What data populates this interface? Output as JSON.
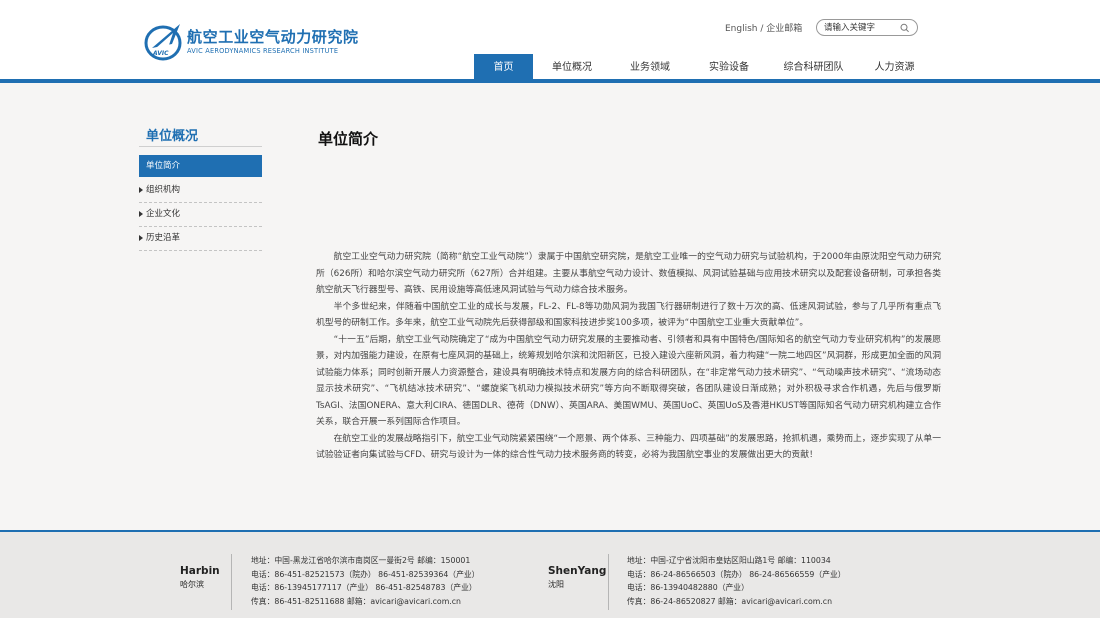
{
  "colors": {
    "brand": "#1f6fb2",
    "background": "#f6f5f4",
    "footer_bg": "#e9e8e7"
  },
  "logo": {
    "icon": "avic-swept-wing-logo-icon",
    "mark_text": "AVIC",
    "title": "航空工业空气动力研究院",
    "subtitle": "AVIC AERODYNAMICS RESEARCH INSTITUTE"
  },
  "header": {
    "english_link": "English",
    "separator": " / ",
    "email_link": "企业邮箱",
    "search": {
      "placeholder": "请输入关键字",
      "icon": "search-icon"
    }
  },
  "nav": {
    "items": [
      {
        "label": "首页",
        "active": true
      },
      {
        "label": "单位概况",
        "active": false
      },
      {
        "label": "业务领域",
        "active": false
      },
      {
        "label": "实验设备",
        "active": false
      },
      {
        "label": "综合科研团队",
        "active": false
      },
      {
        "label": "人力资源",
        "active": false
      }
    ]
  },
  "sidebar": {
    "title": "单位概况",
    "items": [
      {
        "label": "单位简介",
        "active": true
      },
      {
        "label": "组织机构",
        "active": false
      },
      {
        "label": "企业文化",
        "active": false
      },
      {
        "label": "历史沿革",
        "active": false
      }
    ]
  },
  "content": {
    "title": "单位简介",
    "paragraphs": [
      "航空工业空气动力研究院（简称“航空工业气动院”）隶属于中国航空研究院，是航空工业唯一的空气动力研究与试验机构，于2000年由原沈阳空气动力研究所（626所）和哈尔滨空气动力研究所（627所）合并组建。主要从事航空气动力设计、数值模拟、风洞试验基础与应用技术研究以及配套设备研制，可承担各类航空航天飞行器型号、高铁、民用设施等高低速风洞试验与气动力综合技术服务。",
      "半个多世纪来，伴随着中国航空工业的成长与发展，FL-2、FL-8等功勋风洞为我国飞行器研制进行了数十万次的高、低速风洞试验，参与了几乎所有重点飞机型号的研制工作。多年来，航空工业气动院先后获得部级和国家科技进步奖100多项，被评为“中国航空工业重大贡献单位”。",
      "“十一五”后期，航空工业气动院确定了“成为中国航空气动力研究发展的主要推动者、引领者和具有中国特色/国际知名的航空气动力专业研究机构”的发展愿景，对内加强能力建设，在原有七座风洞的基础上，统筹规划哈尔滨和沈阳新区，已投入建设六座新风洞，着力构建“一院二地四区”风洞群，形成更加全面的风洞试验能力体系；同时创新开展人力资源整合，建设具有明确技术特点和发展方向的综合科研团队，在“非定常气动力技术研究”、“气动噪声技术研究”、“流场动态显示技术研究”、“飞机结冰技术研究”、“螺旋桨飞机动力模拟技术研究”等方向不断取得突破，各团队建设日渐成熟；对外积极寻求合作机遇，先后与俄罗斯TsAGI、法国ONERA、意大利CIRA、德国DLR、德荷（DNW）、英国ARA、美国WMU、英国UoC、英国UoS及香港HKUST等国际知名气动力研究机构建立合作关系，联合开展一系列国际合作项目。",
      "在航空工业的发展战略指引下，航空工业气动院紧紧围绕“一个愿景、两个体系、三种能力、四项基础”的发展思路，抢抓机遇，乘势而上，逐步实现了从单一试验验证者向集试验与CFD、研究与设计为一体的综合性气动力技术服务商的转变，必将为我国航空事业的发展做出更大的贡献！"
    ]
  },
  "footer": {
    "harbin": {
      "city_en": "Harbin",
      "city_cn": "哈尔滨",
      "lines": [
        "地址：中国-黑龙江省哈尔滨市南岗区一曼街2号 邮编：150001",
        "电话：86-451-82521573（院办）    86-451-82539364（产业）",
        "电话：86-13945177117（产业）     86-451-82548783（产业）",
        "传真：86-451-82511688     邮箱：avicari@avicari.com.cn"
      ]
    },
    "shenyang": {
      "city_en": "ShenYang",
      "city_cn": "沈阳",
      "lines": [
        "地址：中国-辽宁省沈阳市皇姑区阳山路1号 邮编：110034",
        "电话：86-24-86566503（院办）    86-24-86566559（产业）",
        "电话：86-13940482880（产业）",
        "传真：86-24-86520827     邮箱：avicari@avicari.com.cn"
      ]
    }
  }
}
